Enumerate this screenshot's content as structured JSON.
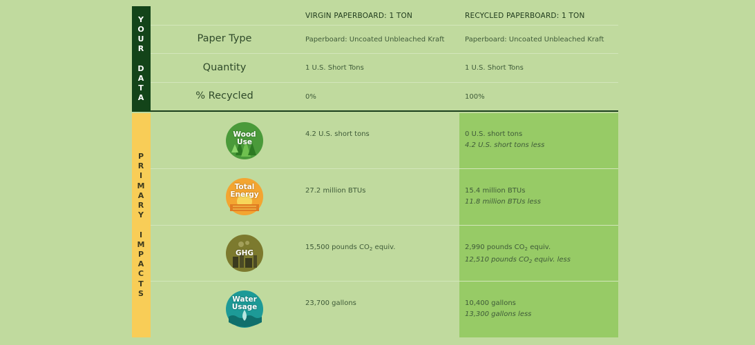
{
  "side": {
    "your_data": [
      "Y",
      "O",
      "U",
      "R",
      "",
      "D",
      "A",
      "T",
      "A"
    ],
    "primary_impacts": [
      "P",
      "R",
      "I",
      "M",
      "A",
      "R",
      "Y",
      "",
      "I",
      "M",
      "P",
      "A",
      "C",
      "T",
      "S"
    ]
  },
  "header": {
    "virgin": "VIRGIN PAPERBOARD: 1 TON",
    "recycled": "RECYCLED PAPERBOARD: 1 TON"
  },
  "rows": [
    {
      "label": "Paper Type",
      "virgin": "Paperboard: Uncoated Unbleached Kraft",
      "recycled": "Paperboard: Uncoated Unbleached Kraft"
    },
    {
      "label": "Quantity",
      "virgin": "1 U.S. Short Tons",
      "recycled": "1 U.S. Short Tons"
    },
    {
      "label": "% Recycled",
      "virgin": "0%",
      "recycled": "100%"
    }
  ],
  "impacts": [
    {
      "icon": "trees-icon",
      "label1": "Wood",
      "label2": "Use",
      "virgin": "4.2 U.S. short tons",
      "recycled": "0 U.S. short tons",
      "less": "4.2 U.S. short tons less",
      "color": "#4a9a3a"
    },
    {
      "icon": "sun-icon",
      "label1": "Total",
      "label2": "Energy",
      "virgin": "27.2 million BTUs",
      "recycled": "15.4 million BTUs",
      "less": "11.8 million BTUs less",
      "color": "#f3a531"
    },
    {
      "icon": "factory-icon",
      "label1": "GHG",
      "label2": "",
      "virgin_pre": "15,500 pounds CO",
      "virgin_post": " equiv.",
      "recycled_pre": "2,990 pounds CO",
      "recycled_post": " equiv.",
      "less_pre": "12,510 pounds CO",
      "less_post": " equiv. less",
      "sub": "2",
      "color": "#7c7a2e"
    },
    {
      "icon": "water-drop-icon",
      "label1": "Water",
      "label2": "Usage",
      "virgin": "23,700 gallons",
      "recycled": "10,400 gallons",
      "less": "13,300 gallons less",
      "color": "#1d9a97"
    }
  ]
}
